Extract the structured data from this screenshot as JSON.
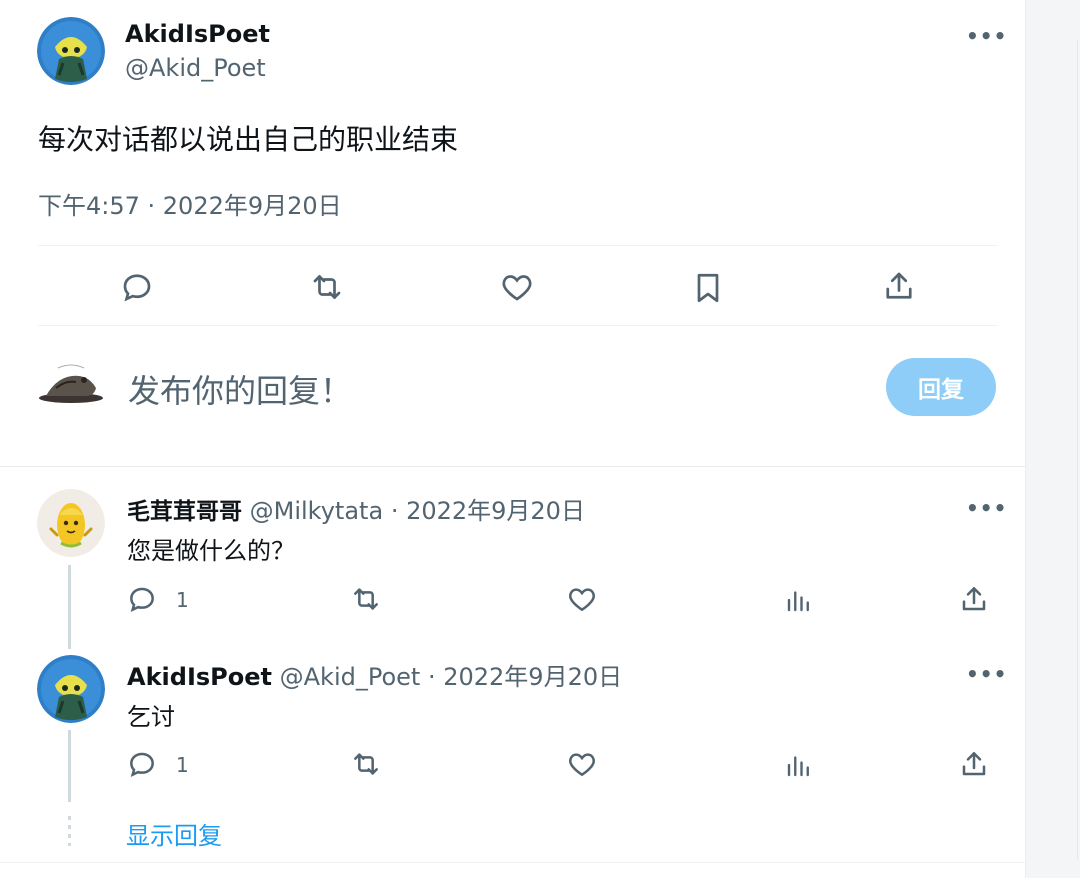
{
  "main_tweet": {
    "author_name": "AkidIsPoet",
    "author_handle": "@Akid_Poet",
    "text": "每次对话都以说出自己的职业结束",
    "timestamp": "下午4:57 · 2022年9月20日",
    "actions": [
      "reply-icon",
      "retweet-icon",
      "like-icon",
      "bookmark-icon",
      "share-icon"
    ]
  },
  "composer": {
    "placeholder": "发布你的回复！",
    "reply_button": "回复"
  },
  "replies": [
    {
      "author_name": "毛茸茸哥哥",
      "author_handle": "@Milkytata",
      "date": "· 2022年9月20日",
      "text": "您是做什么的？",
      "reply_count": "1"
    },
    {
      "author_name": "AkidIsPoet",
      "author_handle": "@Akid_Poet",
      "date": "· 2022年9月20日",
      "text": "乞讨",
      "reply_count": "1"
    }
  ],
  "show_replies_label": "显示回复",
  "colors": {
    "accent": "#1d9bf0",
    "reply_button_disabled": "#8ecdf8",
    "muted_text": "#536471"
  }
}
